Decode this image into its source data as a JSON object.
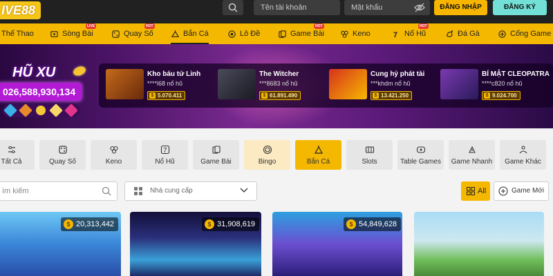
{
  "header": {
    "logo_text": "IVE88",
    "username_placeholder": "Tên tài khoản",
    "password_placeholder": "Mật khẩu",
    "login_label": "ĐĂNG NHẬP",
    "register_label": "ĐĂNG KÝ"
  },
  "nav": {
    "items": [
      {
        "label": "Thể Thao",
        "icon": "sports-icon"
      },
      {
        "label": "Sòng Bài",
        "icon": "casino-icon",
        "badge": "LIVE"
      },
      {
        "label": "Quay Số",
        "icon": "lottery-icon",
        "badge": "HOT"
      },
      {
        "label": "Bắn Cá",
        "icon": "fishing-icon"
      },
      {
        "label": "Lô Đề",
        "icon": "lode-icon"
      },
      {
        "label": "Game Bài",
        "icon": "cards-icon",
        "badge": "HOT"
      },
      {
        "label": "Keno",
        "icon": "keno-icon"
      },
      {
        "label": "Nổ Hũ",
        "icon": "slot-icon",
        "badge": "HOT"
      },
      {
        "label": "Đá Gà",
        "icon": "cockfight-icon"
      },
      {
        "label": "Cổng Game",
        "icon": "gamepad-icon"
      }
    ]
  },
  "jackpot": {
    "title": "HŨ XU",
    "amount": "026,588,930,134",
    "winners": [
      {
        "game": "Kho báu tứ Linh",
        "player": "****l68 nổ hũ",
        "win": "5.070.411"
      },
      {
        "game": "The Witcher",
        "player": "***8683 nổ hũ",
        "win": "61.891.490"
      },
      {
        "game": "Cung hỷ phát tài",
        "player": "***khdm nổ hũ",
        "win": "13.421.250"
      },
      {
        "game": "BÍ MẬT CLEOPATRA",
        "player": "****c820 nổ hũ",
        "win": "9.024.700"
      }
    ]
  },
  "categories": [
    {
      "label": "Tất Cả",
      "icon": "sliders-icon"
    },
    {
      "label": "Quay Số",
      "icon": "dice-icon"
    },
    {
      "label": "Keno",
      "icon": "keno-balls-icon"
    },
    {
      "label": "Nổ Hũ",
      "icon": "seven-icon"
    },
    {
      "label": "Game Bài",
      "icon": "playing-cards-icon"
    },
    {
      "label": "Bingo",
      "icon": "bingo-icon"
    },
    {
      "label": "Bắn Cá",
      "icon": "fish-shooter-icon",
      "active": true
    },
    {
      "label": "Slots",
      "icon": "slots-icon"
    },
    {
      "label": "Table Games",
      "icon": "table-games-icon"
    },
    {
      "label": "Game Nhanh",
      "icon": "fast-game-icon"
    },
    {
      "label": "Game Khác",
      "icon": "other-games-icon"
    }
  ],
  "filters": {
    "search_placeholder": "ìm kiếm",
    "provider_label": "Nhà cung cấp",
    "all_label": "All",
    "new_label": "Game Mới"
  },
  "games": [
    {
      "jackpot": "20,313,442"
    },
    {
      "jackpot": "31,908,619"
    },
    {
      "jackpot": "54,849,628"
    },
    {
      "jackpot": ""
    }
  ],
  "colors": {
    "brand_yellow": "#f5b800",
    "header_dark": "#212121",
    "register_teal": "#72e0d6",
    "jackpot_purple": "#b21ad4"
  }
}
